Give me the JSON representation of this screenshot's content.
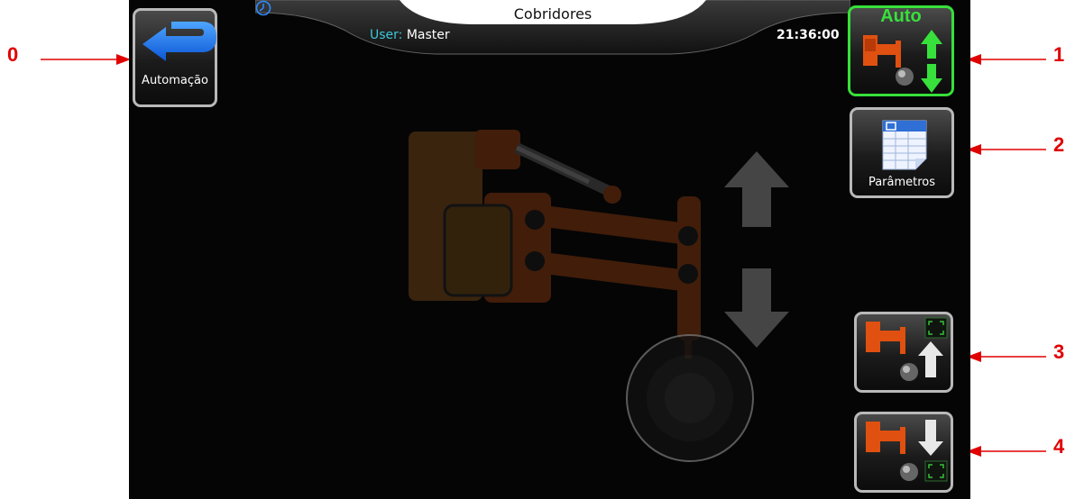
{
  "header": {
    "title": "Cobridores",
    "user_label": "User:",
    "user_name": "Master",
    "time": "21:36:00"
  },
  "buttons": {
    "back_label": "Automação",
    "auto_label": "Auto",
    "params_label": "Parâmetros"
  },
  "callouts": [
    "0",
    "1",
    "2",
    "3",
    "4"
  ],
  "colors": {
    "accent_green": "#37e03a",
    "user_label": "#3cc8d8",
    "callout_red": "#e00000",
    "machine_orange": "#e05010"
  },
  "icons": [
    "back-arrow-icon",
    "clock-icon",
    "auto-mode-icon",
    "parameters-sheet-icon",
    "raise-arm-icon",
    "lower-arm-icon",
    "up-arrow-icon",
    "down-arrow-icon"
  ]
}
